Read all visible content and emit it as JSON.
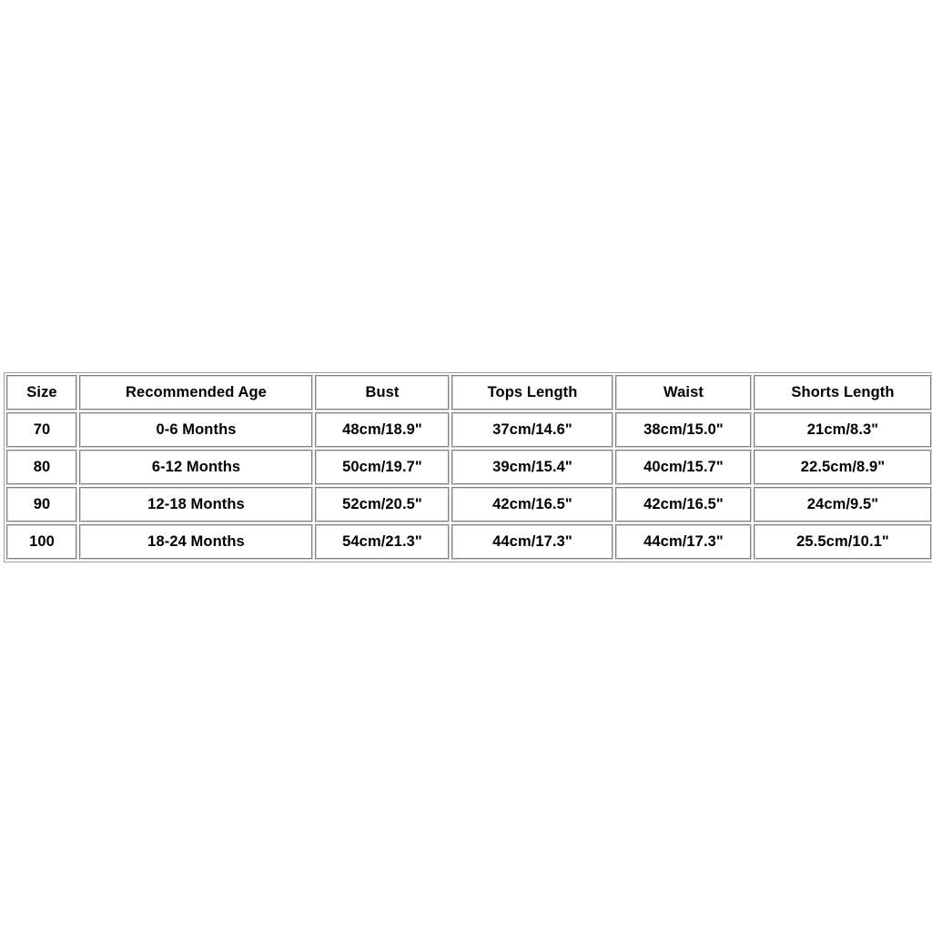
{
  "page": {
    "background_color": "#ffffff",
    "text_color": "#000000",
    "border_color": "#d4d4d4",
    "outer_border_color": "#a0a0a0"
  },
  "size_chart": {
    "columns": [
      "Size",
      "Recommended Age",
      "Bust",
      "Tops Length",
      "Waist",
      "Shorts Length"
    ],
    "rows": [
      {
        "size": "70",
        "recommended_age": "0-6 Months",
        "bust": "48cm/18.9\"",
        "tops_length": "37cm/14.6\"",
        "waist": "38cm/15.0\"",
        "shorts_length": "21cm/8.3\""
      },
      {
        "size": "80",
        "recommended_age": "6-12 Months",
        "bust": "50cm/19.7\"",
        "tops_length": "39cm/15.4\"",
        "waist": "40cm/15.7\"",
        "shorts_length": "22.5cm/8.9\""
      },
      {
        "size": "90",
        "recommended_age": "12-18 Months",
        "bust": "52cm/20.5\"",
        "tops_length": "42cm/16.5\"",
        "waist": "42cm/16.5\"",
        "shorts_length": "24cm/9.5\""
      },
      {
        "size": "100",
        "recommended_age": "18-24 Months",
        "bust": "54cm/21.3\"",
        "tops_length": "44cm/17.3\"",
        "waist": "44cm/17.3\"",
        "shorts_length": "25.5cm/10.1\""
      }
    ]
  }
}
